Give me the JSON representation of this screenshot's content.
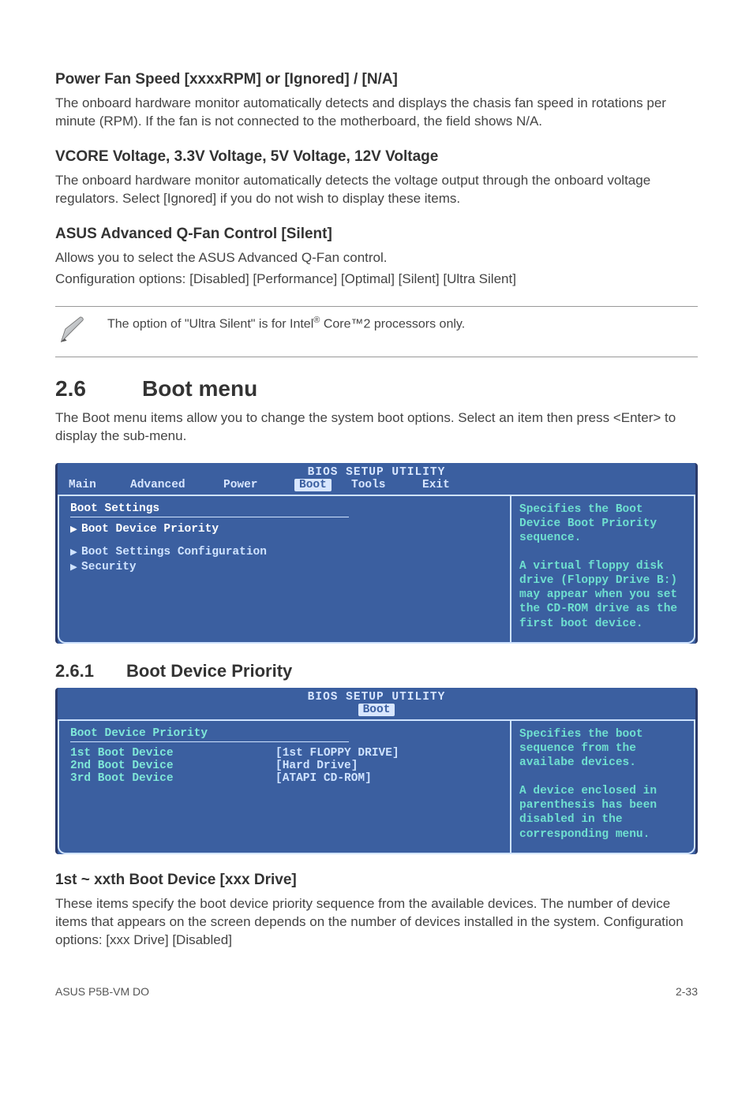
{
  "s1": {
    "h": "Power Fan Speed [xxxxRPM] or [Ignored] / [N/A]",
    "p": "The onboard hardware monitor automatically detects and displays the chasis fan speed in rotations per minute (RPM). If the fan is not connected to the motherboard, the field shows N/A."
  },
  "s2": {
    "h": "VCORE Voltage, 3.3V Voltage, 5V Voltage, 12V Voltage",
    "p": "The onboard hardware monitor automatically detects the voltage output through the onboard voltage regulators. Select [Ignored] if you do not wish to display these items."
  },
  "s3": {
    "h": "ASUS Advanced Q-Fan Control [Silent]",
    "p1": "Allows you to select the ASUS Advanced Q-Fan control.",
    "p2": "Configuration options: [Disabled] [Performance] [Optimal] [Silent] [Ultra Silent]"
  },
  "note": {
    "pre": "The option of \"Ultra Silent\" is for Intel",
    "sup": "®",
    "post": " Core™2 processors only."
  },
  "sec26": {
    "num": "2.6",
    "title": "Boot menu",
    "p": "The Boot menu items allow you to change the system boot options. Select an item then press <Enter> to display the sub-menu."
  },
  "bios1": {
    "title": "BIOS SETUP UTILITY",
    "tabs": {
      "main": "Main",
      "advanced": "Advanced",
      "power": "Power",
      "boot": "Boot",
      "tools": "Tools",
      "exit": "Exit"
    },
    "left": {
      "heading": "Boot Settings",
      "items": [
        "Boot Device Priority",
        "Boot Settings Configuration",
        "Security"
      ],
      "selectedIndex": 0
    },
    "right": "Specifies the Boot Device Boot Priority sequence.\n\nA virtual floppy disk drive (Floppy Drive B:) may appear when you set the CD-ROM drive as the first boot device."
  },
  "sec261": {
    "n": "2.6.1",
    "t": "Boot Device Priority"
  },
  "bios2": {
    "title": "BIOS SETUP UTILITY",
    "tabSel": "Boot",
    "left": {
      "heading": "Boot Device Priority",
      "rows": [
        {
          "k": "1st Boot Device",
          "v": "[1st FLOPPY DRIVE]"
        },
        {
          "k": "2nd Boot Device",
          "v": "[Hard Drive]"
        },
        {
          "k": "3rd Boot Device",
          "v": "[ATAPI CD-ROM]"
        }
      ]
    },
    "right": "Specifies the boot sequence from the availabe devices.\n\nA device enclosed in parenthesis has been disabled in the corresponding menu."
  },
  "s4": {
    "h": "1st ~ xxth Boot Device [xxx Drive]",
    "p": "These items specify the boot device priority sequence from the available devices. The number of device items that appears on the screen depends on the number of devices installed in the system. Configuration options: [xxx Drive] [Disabled]"
  },
  "footer": {
    "left": "ASUS P5B-VM DO",
    "right": "2-33"
  }
}
